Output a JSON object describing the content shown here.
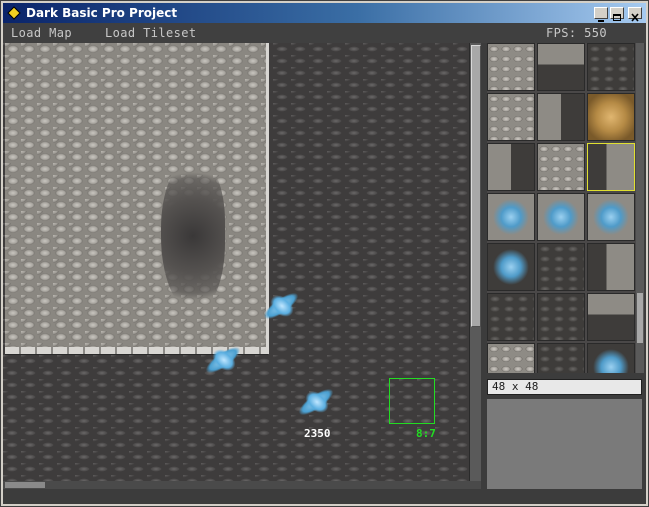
{
  "window": {
    "title": "Dark Basic Pro Project",
    "buttons": {
      "minimize": "minimize-button",
      "maximize": "maximize-button",
      "close": "close-button"
    }
  },
  "menu": {
    "load_map": "Load Map",
    "load_tileset": "Load Tileset",
    "fps_label": "FPS: 550"
  },
  "map": {
    "entity_label": "2350",
    "cursor_coord": "8:7",
    "colors": {
      "cursor": "#22dd22",
      "entity_label": "#ffffff",
      "coord_label": "#22dd22"
    }
  },
  "tileset": {
    "tile_size_label": "48 x 48",
    "selected_tile": "row 3, col 3",
    "colors": {
      "selection": "#e0e030"
    }
  }
}
